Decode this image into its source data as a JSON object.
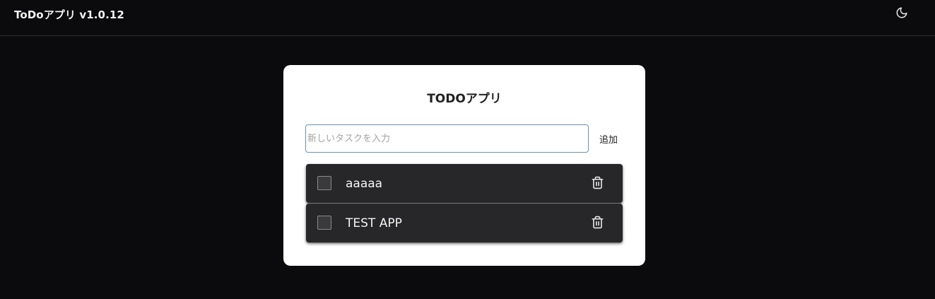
{
  "header": {
    "title": "ToDoアプリ v1.0.12",
    "theme_icon": "moon-icon"
  },
  "card": {
    "title": "TODOアプリ",
    "input": {
      "placeholder": "新しいタスクを入力",
      "value": ""
    },
    "add_label": "追加"
  },
  "tasks": [
    {
      "label": "aaaaa",
      "completed": false
    },
    {
      "label": "TEST APP",
      "completed": false
    }
  ],
  "colors": {
    "background": "#0b0b0d",
    "card": "#ffffff",
    "task_item": "#27272a",
    "input_border": "#6f8fb3"
  }
}
